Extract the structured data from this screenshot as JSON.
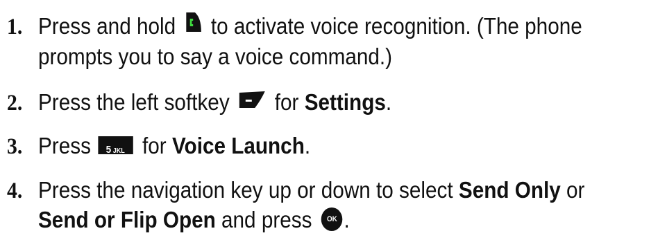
{
  "steps": [
    {
      "number": "1.",
      "line1": [
        "Press and hold ",
        " to activate voice recognition. (The phone"
      ],
      "line2": "prompts you to say a voice command.)",
      "icon": "talk-key-icon"
    },
    {
      "number": "2.",
      "parts": [
        "Press the left softkey ",
        " for ",
        "."
      ],
      "bold": "Settings",
      "icon": "left-softkey-icon"
    },
    {
      "number": "3.",
      "parts": [
        "Press ",
        " for ",
        "."
      ],
      "bold": "Voice Launch",
      "key": {
        "digit": "5",
        "letters": "JKL"
      },
      "icon": "key-5-jkl-icon"
    },
    {
      "number": "4.",
      "line1": [
        "Press the navigation key up or down to select ",
        " or"
      ],
      "line1_bold": "Send Only",
      "line2_bold": "Send or Flip Open",
      "line2": [
        " and press ",
        "."
      ],
      "ok_label": "OK",
      "icon": "ok-key-icon"
    }
  ]
}
